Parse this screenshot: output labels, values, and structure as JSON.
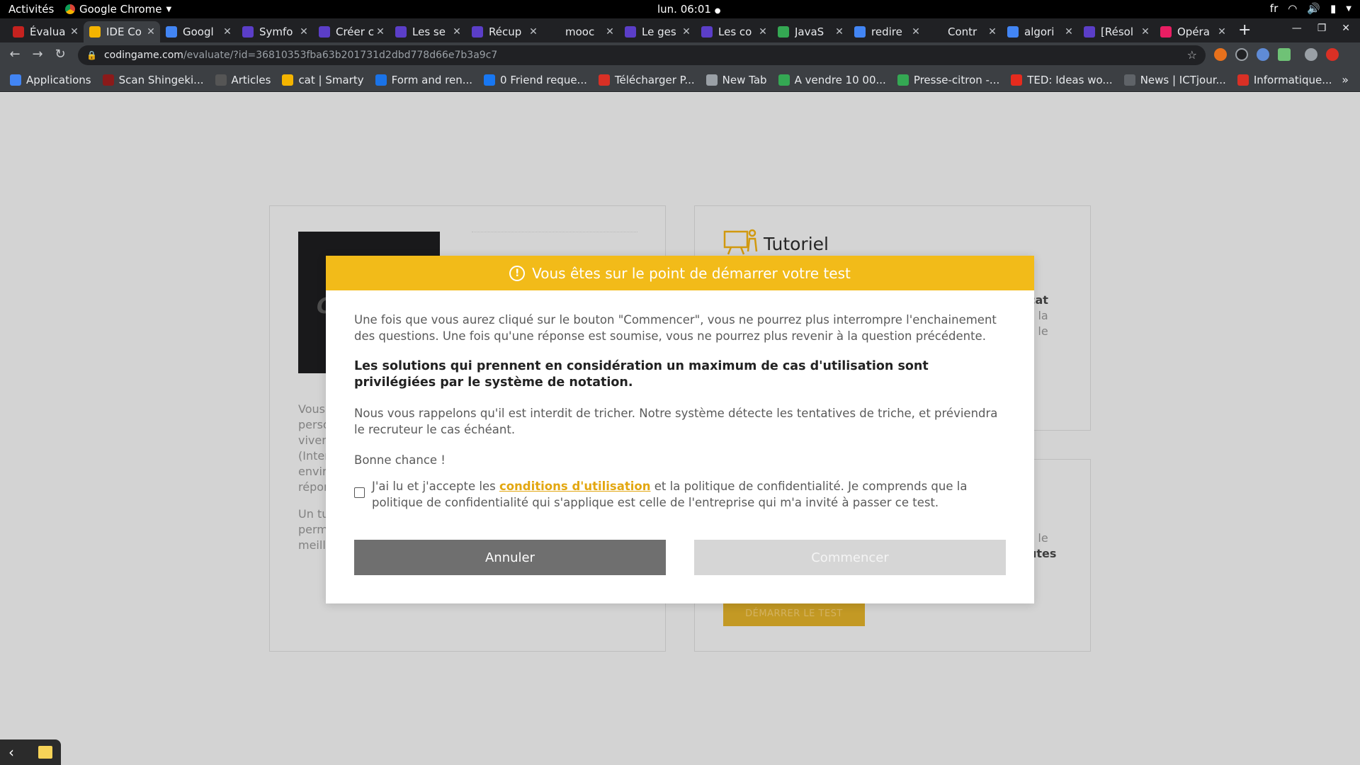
{
  "gnome": {
    "activities": "Activités",
    "app_name": "Google Chrome",
    "clock": "lun. 06:01",
    "lang": "fr"
  },
  "tabs": [
    {
      "title": "Évalua",
      "color": "#c5221f",
      "active": false
    },
    {
      "title": "IDE Co",
      "color": "#f4b400",
      "active": true
    },
    {
      "title": "Googl",
      "color": "#4285f4",
      "active": false
    },
    {
      "title": "Symfo",
      "color": "#5b3ec8",
      "active": false
    },
    {
      "title": "Créer c",
      "color": "#5b3ec8",
      "active": false
    },
    {
      "title": "Les se",
      "color": "#5b3ec8",
      "active": false
    },
    {
      "title": "Récup",
      "color": "#5b3ec8",
      "active": false
    },
    {
      "title": "mooc",
      "color": "#202124",
      "active": false
    },
    {
      "title": "Le ges",
      "color": "#5b3ec8",
      "active": false
    },
    {
      "title": "Les co",
      "color": "#5b3ec8",
      "active": false
    },
    {
      "title": "JavaS",
      "color": "#34a853",
      "active": false
    },
    {
      "title": "redire",
      "color": "#4285f4",
      "active": false
    },
    {
      "title": "Contr",
      "color": "#202124",
      "active": false
    },
    {
      "title": "algori",
      "color": "#4285f4",
      "active": false
    },
    {
      "title": "[Résol",
      "color": "#5b3ec8",
      "active": false
    },
    {
      "title": "Opéra",
      "color": "#e91e63",
      "active": false
    }
  ],
  "url": {
    "host": "codingame.com",
    "path": "/evaluate/?id=36810353fba63b201731d2dbd778d66e7b3a9c7"
  },
  "bookmarks": [
    {
      "label": "Applications",
      "color": "#4285f4"
    },
    {
      "label": "Scan Shingeki...",
      "color": "#8b1a1a"
    },
    {
      "label": "Articles",
      "color": "#555555"
    },
    {
      "label": "cat | Smarty",
      "color": "#f4b400"
    },
    {
      "label": "Form and ren...",
      "color": "#1a73e8"
    },
    {
      "label": "0 Friend reque...",
      "color": "#1877f2"
    },
    {
      "label": "Télécharger P...",
      "color": "#d93025"
    },
    {
      "label": "New Tab",
      "color": "#9aa0a6"
    },
    {
      "label": "A vendre 10 00...",
      "color": "#34a853"
    },
    {
      "label": "Presse-citron -...",
      "color": "#34a853"
    },
    {
      "label": "TED: Ideas wo...",
      "color": "#e62b1e"
    },
    {
      "label": "News | ICTjour...",
      "color": "#5f6368"
    },
    {
      "label": "Informatique...",
      "color": "#d93025"
    }
  ],
  "background": {
    "tutorial_title": "Tutoriel",
    "left_fragments_1": [
      "Vous",
      "perso",
      "vivem",
      "(Inter",
      "enviro",
      "répon"
    ],
    "left_fragments_2": [
      "Un tu",
      "perm",
      "meille"
    ],
    "right_fragments_top": [
      "cat",
      "z la",
      "s le"
    ],
    "right_fragments_bottom": [
      "s le",
      "utes"
    ],
    "start_test": "DÉMARRER LE TEST"
  },
  "modal": {
    "title": "Vous êtes sur le point de démarrer votre test",
    "para1": "Une fois que vous aurez cliqué sur le bouton \"Commencer\", vous ne pourrez plus interrompre l'enchainement des questions. Une fois qu'une réponse est soumise, vous ne pourrez plus revenir à la question précédente.",
    "para2": "Les solutions qui prennent en considération un maximum de cas d'utilisation sont privilégiées par le système de notation.",
    "para3": "Nous vous rappelons qu'il est interdit de tricher. Notre système détecte les tentatives de triche, et préviendra le recruteur le cas échéant.",
    "para4": "Bonne chance !",
    "consent_prefix": "J'ai lu et j'accepte les ",
    "consent_link": "conditions d'utilisation",
    "consent_suffix": " et la politique de confidentialité. Je comprends que la politique de confidentialité qui s'applique est celle de l'entreprise qui m'a invité à passer ce test.",
    "cancel_label": "Annuler",
    "start_label": "Commencer",
    "accent": "#f2bb19"
  }
}
